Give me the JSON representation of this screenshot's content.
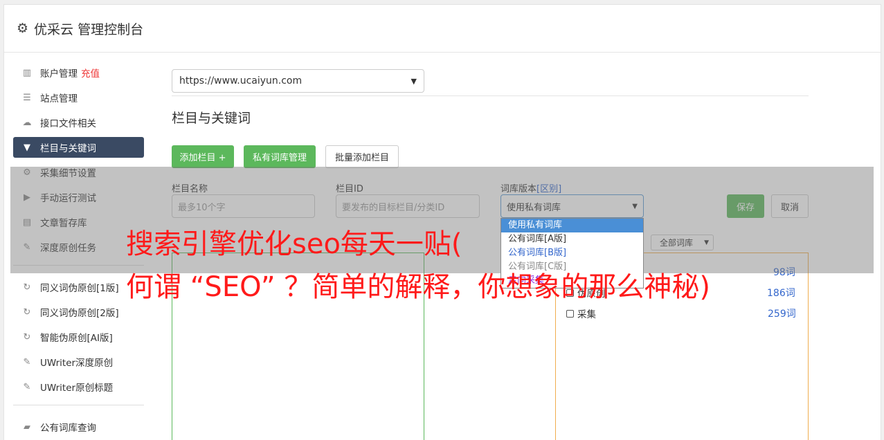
{
  "header": {
    "title": "优采云 管理控制台"
  },
  "sidebar": {
    "items": [
      {
        "label": "账户管理",
        "extra": "充值"
      },
      {
        "label": "站点管理"
      },
      {
        "label": "接口文件相关"
      },
      {
        "label": "栏目与关键词"
      },
      {
        "label": "采集细节设置"
      },
      {
        "label": "手动运行测试"
      },
      {
        "label": "文章暂存库"
      },
      {
        "label": "深度原创任务"
      },
      {
        "label": "同义词伪原创[1版]"
      },
      {
        "label": "同义词伪原创[2版]"
      },
      {
        "label": "智能伪原创[AI版]"
      },
      {
        "label": "UWriter深度原创"
      },
      {
        "label": "UWriter原创标题"
      },
      {
        "label": "公有词库查询"
      }
    ]
  },
  "main": {
    "site_select": "https://www.ucaiyun.com",
    "section_title": "栏目与关键词",
    "buttons": {
      "add_column": "添加栏目 +",
      "private_lib": "私有词库管理",
      "batch_add": "批量添加栏目"
    },
    "form": {
      "name_label": "栏目名称",
      "name_placeholder": "最多10个字",
      "id_label": "栏目ID",
      "id_placeholder": "要发布的目标栏目/分类ID",
      "lib_label": "词库版本",
      "lib_label_extra": "[区别]",
      "lib_value": "使用私有词库",
      "save": "保存",
      "cancel": "取消"
    },
    "dropdown_options": [
      "使用私有词库",
      "公有词库[A版]",
      "公有词库[B版]",
      "公有词库[C版]",
      "走向采集"
    ],
    "all_lib": "全部词库",
    "lib_list": [
      {
        "label": "",
        "count": "98词"
      },
      {
        "label": "伪原创",
        "count": "186词"
      },
      {
        "label": "采集",
        "count": "259词"
      }
    ]
  },
  "watermark": {
    "line1": "搜索引擎优化seo每天一贴(",
    "line2": "何谓 “SEO” ？简单的解释，你想象的那么神秘)"
  }
}
